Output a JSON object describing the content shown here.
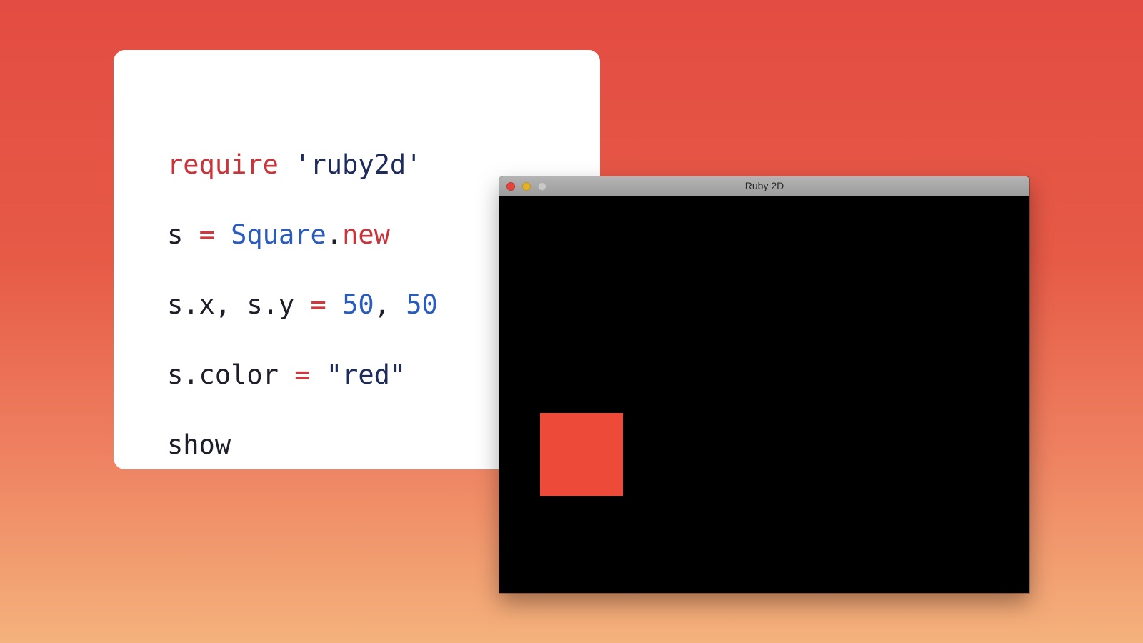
{
  "code": {
    "lines": [
      [
        {
          "text": "require",
          "kind": "keyword"
        },
        {
          "text": " ",
          "kind": "plain"
        },
        {
          "text": "'ruby2d'",
          "kind": "string"
        }
      ],
      [
        {
          "text": "s",
          "kind": "plain"
        },
        {
          "text": " ",
          "kind": "plain"
        },
        {
          "text": "=",
          "kind": "op"
        },
        {
          "text": " ",
          "kind": "plain"
        },
        {
          "text": "Square",
          "kind": "const"
        },
        {
          "text": ".",
          "kind": "plain"
        },
        {
          "text": "new",
          "kind": "keyword"
        }
      ],
      [
        {
          "text": "s.x, s.y",
          "kind": "plain"
        },
        {
          "text": " ",
          "kind": "plain"
        },
        {
          "text": "=",
          "kind": "op"
        },
        {
          "text": " ",
          "kind": "plain"
        },
        {
          "text": "50",
          "kind": "number"
        },
        {
          "text": ", ",
          "kind": "plain"
        },
        {
          "text": "50",
          "kind": "number"
        }
      ],
      [
        {
          "text": "s.color",
          "kind": "plain"
        },
        {
          "text": " ",
          "kind": "plain"
        },
        {
          "text": "=",
          "kind": "op"
        },
        {
          "text": " ",
          "kind": "plain"
        },
        {
          "text": "\"red\"",
          "kind": "string"
        }
      ],
      [
        {
          "text": "show",
          "kind": "plain"
        }
      ]
    ]
  },
  "window": {
    "title": "Ruby 2D",
    "square_color": "#ee4a3a"
  },
  "colors": {
    "keyword": "#c9343a",
    "string": "#1c2b5c",
    "op": "#d0383e",
    "const": "#2a5cc0",
    "number": "#2a5cc0",
    "plain": "#1e1e2a"
  }
}
